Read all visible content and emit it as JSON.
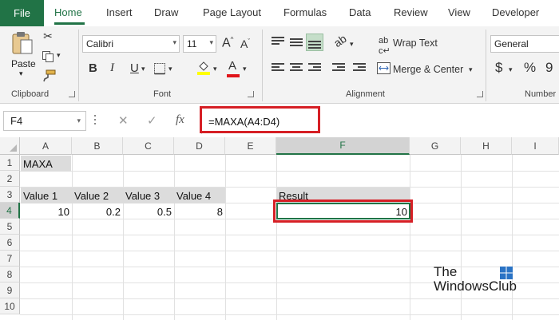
{
  "ribbon_tabs": [
    "File",
    "Home",
    "Insert",
    "Draw",
    "Page Layout",
    "Formulas",
    "Data",
    "Review",
    "View",
    "Developer"
  ],
  "active_tab": "Home",
  "clipboard": {
    "paste_label": "Paste",
    "group_label": "Clipboard"
  },
  "font": {
    "name": "Calibri",
    "size": "11",
    "group_label": "Font"
  },
  "alignment": {
    "wrap_text": "Wrap Text",
    "merge_center": "Merge & Center",
    "group_label": "Alignment"
  },
  "number": {
    "format": "General",
    "group_label": "Number",
    "currency_symbol": "$",
    "percent_symbol": "%"
  },
  "formula_bar": {
    "name_box": "F4",
    "fx_label": "fx",
    "formula": "=MAXA(A4:D4)"
  },
  "columns": [
    "A",
    "B",
    "C",
    "D",
    "E",
    "F",
    "G",
    "H",
    "I"
  ],
  "rows": [
    "1",
    "2",
    "3",
    "4",
    "5",
    "6",
    "7",
    "8",
    "9",
    "10"
  ],
  "cells": {
    "A1": "MAXA",
    "A3": "Value 1",
    "B3": "Value 2",
    "C3": "Value 3",
    "D3": "Value 4",
    "F3": "Result",
    "A4": "10",
    "B4": "0.2",
    "C4": "0.5",
    "D4": "8",
    "F4": "10"
  },
  "watermark": {
    "line1": "The",
    "line2": "WindowsClub"
  },
  "colors": {
    "accent": "#217346",
    "highlight": "#d61f25",
    "header_shade": "#dcdcdc"
  }
}
